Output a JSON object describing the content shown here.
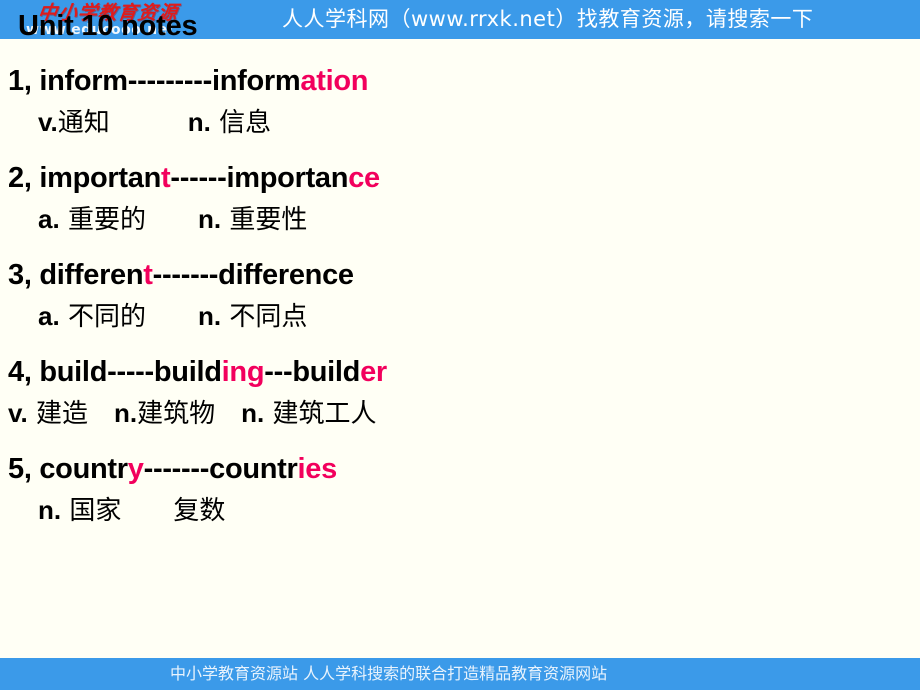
{
  "slide": {
    "title": "Unit 10 notes",
    "background_color": "#FFFFF5",
    "accent_color": "#F2005C",
    "banner_color": "#3B9AE9"
  },
  "top_banner": {
    "text": "人人学科网（www.rrxk.net）找教育资源，请搜索一下",
    "logo_cn": "中小学教育资源",
    "logo_url": "www.educooo.net"
  },
  "bottom_banner": {
    "text": "中小学教育资源站 人人学科搜索的联合打造精品教育资源网站"
  },
  "entries": [
    {
      "index": "1,",
      "word_parts": [
        {
          "text": " inform---------inform",
          "highlight": false
        },
        {
          "text": "ation",
          "highlight": true
        }
      ],
      "gloss": [
        {
          "pos": "v.",
          "cn": "通知"
        },
        {
          "pos": "n.",
          "cn": " 信息"
        }
      ],
      "gloss_indent": "indent-1",
      "gloss_gap": "gap-lg"
    },
    {
      "index": "2,",
      "word_parts": [
        {
          "text": " importan",
          "highlight": false
        },
        {
          "text": "t",
          "highlight": true
        },
        {
          "text": "------importan",
          "highlight": false
        },
        {
          "text": "ce",
          "highlight": true
        }
      ],
      "gloss": [
        {
          "pos": "a.",
          "cn": " 重要的"
        },
        {
          "pos": "n.",
          "cn": " 重要性"
        }
      ],
      "gloss_indent": "indent-1",
      "gloss_gap": "gap-md"
    },
    {
      "index": "3,",
      "word_parts": [
        {
          "text": " differen",
          "highlight": false
        },
        {
          "text": "t",
          "highlight": true
        },
        {
          "text": "-------difference",
          "highlight": false
        }
      ],
      "gloss": [
        {
          "pos": "a.",
          "cn": " 不同的"
        },
        {
          "pos": "n.",
          "cn": " 不同点"
        }
      ],
      "gloss_indent": "indent-1",
      "gloss_gap": "gap-md"
    },
    {
      "index": "4,",
      "word_parts": [
        {
          "text": " build-----build",
          "highlight": false
        },
        {
          "text": "ing",
          "highlight": true
        },
        {
          "text": "---build",
          "highlight": false
        },
        {
          "text": "er",
          "highlight": true
        }
      ],
      "gloss": [
        {
          "pos": "v.",
          "cn": " 建造"
        },
        {
          "pos": "n.",
          "cn": "建筑物"
        },
        {
          "pos": "n.",
          "cn": " 建筑工人"
        }
      ],
      "gloss_indent": "indent-0",
      "gloss_gap": "gap-sm"
    },
    {
      "index": "5,",
      "word_parts": [
        {
          "text": " countr",
          "highlight": false
        },
        {
          "text": "y",
          "highlight": true
        },
        {
          "text": "-------countr",
          "highlight": false
        },
        {
          "text": "ies",
          "highlight": true
        }
      ],
      "gloss": [
        {
          "pos": "n.",
          "cn": "  国家"
        },
        {
          "pos": "",
          "cn": "复数"
        }
      ],
      "gloss_indent": "indent-1",
      "gloss_gap": "gap-md"
    }
  ]
}
